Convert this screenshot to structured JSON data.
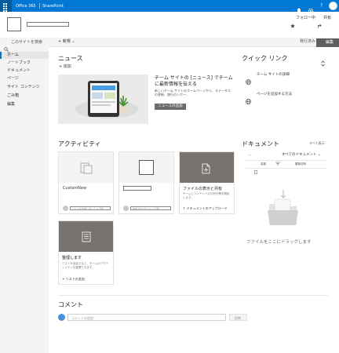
{
  "suite": {
    "app": "Office 365",
    "site": "SharePoint",
    "help": "?"
  },
  "header": {
    "follow": "フォロー中",
    "share": "共有"
  },
  "search": {
    "placeholder": "このサイトを検索"
  },
  "nav": [
    {
      "label": "ホーム"
    },
    {
      "label": "ノートブック"
    },
    {
      "label": "ドキュメント"
    },
    {
      "label": "ページ"
    },
    {
      "label": "サイト コンテンツ"
    },
    {
      "label": "ごみ箱"
    },
    {
      "label": "編集"
    }
  ],
  "command": {
    "new": "新規",
    "publish_status": "発行済み",
    "edit": "編集"
  },
  "news": {
    "title": "ニュース",
    "add": "追加",
    "headline": "チーム サイトの [ニュース] でチームに最新情報を伝える",
    "body": "新しいチーム サイトのホームページから、ステータスの更新、旅行のレポー...",
    "button": "ニュースの追加"
  },
  "quicklinks": {
    "title": "クイック リンク",
    "items": [
      {
        "label": "チーム サイトの詳細"
      },
      {
        "label": "ページを追加する方法"
      }
    ]
  },
  "activity": {
    "title": "アクティビティ",
    "cards": [
      {
        "title": "CustomNew",
        "meta": "リストを作成しました 1 日前"
      },
      {
        "title": "",
        "meta": "作成されたサイト 1 日前"
      },
      {
        "title": "ファイルの表示と共有",
        "desc": "チームとコンテンツの共有作業を開始します。",
        "action": "ドキュメントのアップロード"
      },
      {
        "title": "整理します",
        "desc": "リストを追加すると、チームのアクティビティを整理できます。",
        "action": "リストの追加"
      }
    ]
  },
  "documents": {
    "title": "ドキュメント",
    "see_all": "すべて表示",
    "view": "すべてのドキュメント",
    "col_name": "名前",
    "col_modified": "更新日時",
    "drop_text": "ファイルをここにドラッグします"
  },
  "comments": {
    "title": "コメント",
    "placeholder": "コメントの追加",
    "post": "投稿"
  }
}
